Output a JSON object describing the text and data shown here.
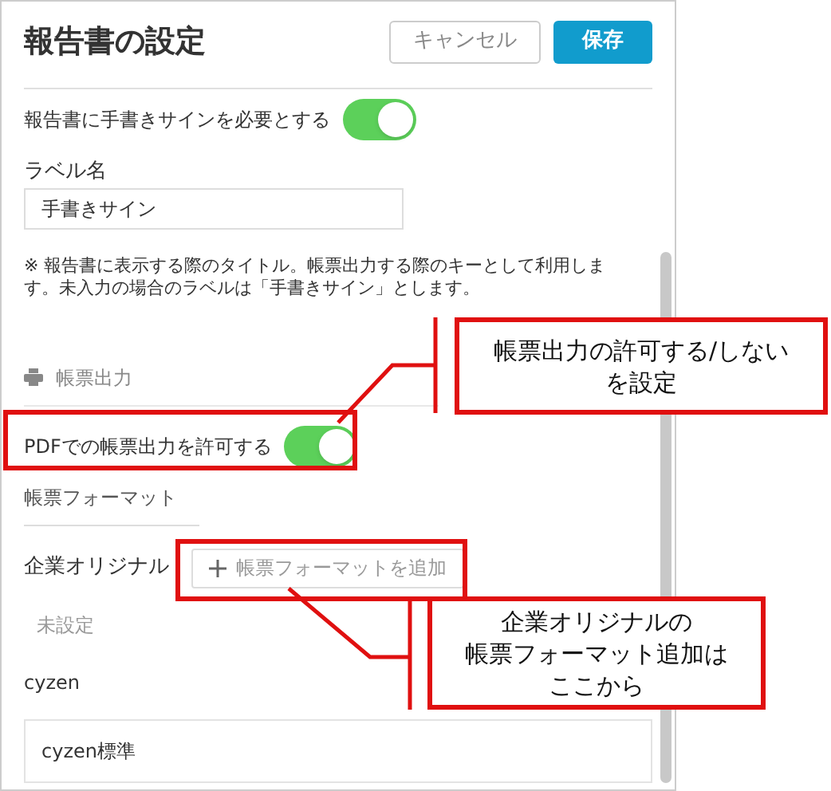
{
  "header": {
    "title": "報告書の設定",
    "buttons": [
      {
        "label": "キャンセル",
        "kind": "secondary"
      },
      {
        "label": "保存",
        "kind": "primary"
      }
    ]
  },
  "signature": {
    "label": "報告書に手書きサインを必要とする",
    "on": true
  },
  "label_field": {
    "label": "ラベル名",
    "value": "手書きサイン"
  },
  "note": "※ 報告書に表示する際のタイトル。帳票出力する際のキーとして利用します。未入力の場合のラベルは「手書きサイン」とします。",
  "section": {
    "title": "帳票出力"
  },
  "pdf": {
    "label": "PDFでの帳票出力を許可する",
    "on": true
  },
  "format_tab": "帳票フォーマット",
  "company": {
    "label": "企業オリジナル",
    "add_button": "帳票フォーマットを追加",
    "empty": "未設定"
  },
  "cyzen": {
    "label": "cyzen",
    "items": [
      "cyzen標準"
    ]
  },
  "callouts": [
    {
      "lines": [
        "帳票出力の許可する/しない",
        "を設定"
      ]
    },
    {
      "lines": [
        "企業オリジナルの",
        "帳票フォーマット追加は",
        "ここから"
      ]
    }
  ]
}
